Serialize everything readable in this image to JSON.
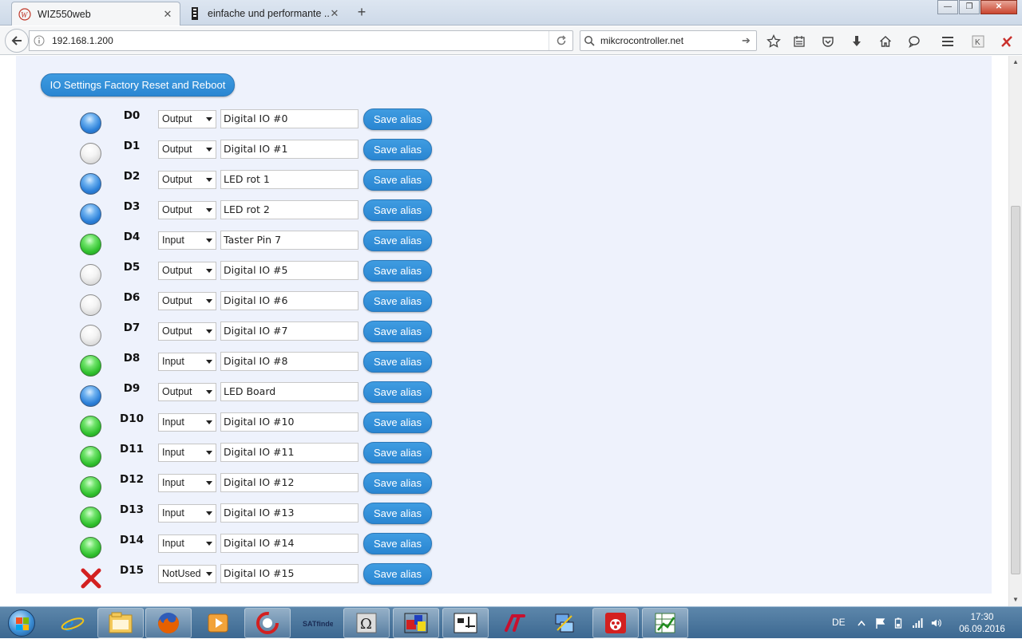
{
  "browser": {
    "tabs": [
      {
        "title": "WIZ550web",
        "active": true
      },
      {
        "title": "einfache und performante ...",
        "active": false
      }
    ],
    "url": "192.168.1.200",
    "search_value": "mikcrocontroller.net"
  },
  "page": {
    "reset_button_label": "IO Settings Factory Reset and Reboot",
    "save_alias_label": "Save alias",
    "io_rows": [
      {
        "pin": "D0",
        "state": "blue",
        "mode": "Output",
        "alias": "Digital IO #0"
      },
      {
        "pin": "D1",
        "state": "off",
        "mode": "Output",
        "alias": "Digital IO #1"
      },
      {
        "pin": "D2",
        "state": "blue",
        "mode": "Output",
        "alias": "LED rot 1"
      },
      {
        "pin": "D3",
        "state": "blue",
        "mode": "Output",
        "alias": "LED rot 2"
      },
      {
        "pin": "D4",
        "state": "green",
        "mode": "Input",
        "alias": "Taster Pin 7"
      },
      {
        "pin": "D5",
        "state": "off",
        "mode": "Output",
        "alias": "Digital IO #5"
      },
      {
        "pin": "D6",
        "state": "off",
        "mode": "Output",
        "alias": "Digital IO #6"
      },
      {
        "pin": "D7",
        "state": "off",
        "mode": "Output",
        "alias": "Digital IO #7"
      },
      {
        "pin": "D8",
        "state": "green",
        "mode": "Input",
        "alias": "Digital IO #8"
      },
      {
        "pin": "D9",
        "state": "blue",
        "mode": "Output",
        "alias": "LED Board"
      },
      {
        "pin": "D10",
        "state": "green",
        "mode": "Input",
        "alias": "Digital IO #10"
      },
      {
        "pin": "D11",
        "state": "green",
        "mode": "Input",
        "alias": "Digital IO #11"
      },
      {
        "pin": "D12",
        "state": "green",
        "mode": "Input",
        "alias": "Digital IO #12"
      },
      {
        "pin": "D13",
        "state": "green",
        "mode": "Input",
        "alias": "Digital IO #13"
      },
      {
        "pin": "D14",
        "state": "green",
        "mode": "Input",
        "alias": "Digital IO #14"
      },
      {
        "pin": "D15",
        "state": "notused",
        "mode": "NotUsed",
        "alias": "Digital IO #15"
      }
    ]
  },
  "taskbar": {
    "language": "DE",
    "time": "17:30",
    "date": "06.09.2016",
    "apps": [
      "internet-explorer",
      "file-explorer",
      "firefox",
      "media-player",
      "ccleaner",
      "satfinder",
      "charmap",
      "paint-app",
      "circuit-app",
      "ltspice",
      "network-tool",
      "raspberry-app",
      "spreadsheet-app"
    ]
  },
  "colors": {
    "accent_button": "#2a86d2",
    "panel_bg": "#eef2fc",
    "led_blue": "#2b7fd8",
    "led_green": "#2fc02d",
    "notused_red": "#d32020"
  }
}
